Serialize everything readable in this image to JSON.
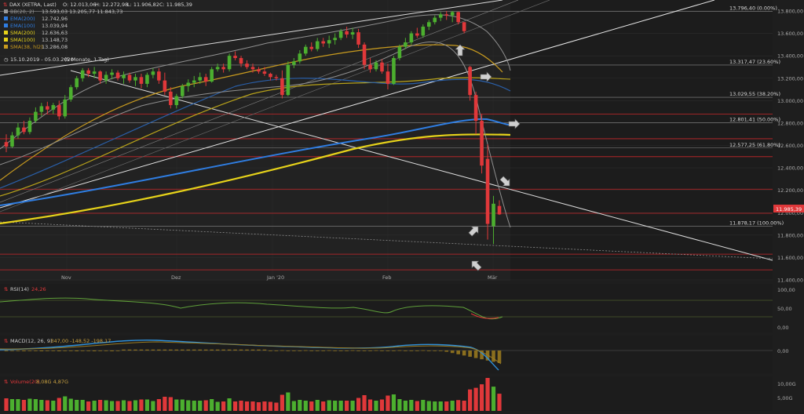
{
  "header": {
    "title": "DAX (XETRA, Last)",
    "ohlc": {
      "o": "O: 12.013,06",
      "h": "H: 12.272,98",
      "l": "L: 11.906,82",
      "c": "C: 11.985,39"
    },
    "period": "15.10.2019 - 05.03.2020",
    "interval": "(5 Monate, 1 Tag)"
  },
  "indicators": [
    {
      "name": "BB(20, 2)",
      "value": "13.593,03   13.205,77   11.843,73",
      "color": "#9a9a9a"
    },
    {
      "name": "EMA(200)",
      "value": "12.742,96",
      "color": "#2f7de1"
    },
    {
      "name": "EMA(100)",
      "value": "13.039,94",
      "color": "#2f7de1"
    },
    {
      "name": "SMA(200)",
      "value": "12.636,63",
      "color": "#e6d21a"
    },
    {
      "name": "SMA(100)",
      "value": "13.148,73",
      "color": "#e6d21a"
    },
    {
      "name": "SMA(38, hl2)",
      "value": "13.286,08",
      "color": "#c79a1f"
    }
  ],
  "colors": {
    "up": "#4caf2f",
    "down": "#e0383a",
    "price_tag": "#e0383a"
  },
  "chart_data": {
    "type": "candlestick",
    "x_tick_labels": [
      "Nov",
      "Dez",
      "Jan '20",
      "Feb",
      "Mär"
    ],
    "y_ticks": [
      "13.800,00",
      "13.600,00",
      "13.400,00",
      "13.200,00",
      "13.000,00",
      "12.800,00",
      "12.600,00",
      "12.400,00",
      "12.200,00",
      "12.000,00",
      "11.800,00",
      "11.600,00",
      "11.400,00"
    ],
    "ylim": [
      11400,
      13900
    ],
    "last_price": "11.985,39",
    "fib_levels": [
      {
        "label": "13.796,40 (0.00%)",
        "value": 13796.4
      },
      {
        "label": "13.317,47 (23.60%)",
        "value": 13317.47
      },
      {
        "label": "13.029,55 (38.20%)",
        "value": 13029.55
      },
      {
        "label": "12.801,41 (50.00%)",
        "value": 12801.41
      },
      {
        "label": "12.577,25 (61.80%)",
        "value": 12577.25
      },
      {
        "label": "11.878,17 (100.00%)",
        "value": 11878.17
      }
    ],
    "horizontal_lines": [
      12880,
      12660,
      12500,
      12210,
      11995,
      11630,
      11490
    ],
    "candles": [
      [
        12630,
        12700,
        12540,
        12590
      ],
      [
        12590,
        12720,
        12580,
        12690
      ],
      [
        12690,
        12800,
        12660,
        12760
      ],
      [
        12760,
        12820,
        12700,
        12720
      ],
      [
        12720,
        12850,
        12700,
        12820
      ],
      [
        12820,
        12940,
        12800,
        12900
      ],
      [
        12900,
        12980,
        12860,
        12950
      ],
      [
        12950,
        12990,
        12880,
        12920
      ],
      [
        12920,
        12980,
        12880,
        12960
      ],
      [
        12960,
        13000,
        12830,
        12860
      ],
      [
        12860,
        13050,
        12840,
        13010
      ],
      [
        13010,
        13140,
        12990,
        13120
      ],
      [
        13120,
        13220,
        13100,
        13200
      ],
      [
        13200,
        13290,
        13170,
        13270
      ],
      [
        13270,
        13290,
        13210,
        13240
      ],
      [
        13240,
        13300,
        13200,
        13260
      ],
      [
        13260,
        13270,
        13150,
        13180
      ],
      [
        13180,
        13260,
        13150,
        13230
      ],
      [
        13230,
        13280,
        13190,
        13250
      ],
      [
        13250,
        13270,
        13180,
        13200
      ],
      [
        13200,
        13260,
        13150,
        13230
      ],
      [
        13230,
        13250,
        13160,
        13180
      ],
      [
        13180,
        13240,
        13130,
        13210
      ],
      [
        13210,
        13240,
        13110,
        13150
      ],
      [
        13150,
        13250,
        13120,
        13230
      ],
      [
        13230,
        13290,
        13200,
        13260
      ],
      [
        13260,
        13290,
        13150,
        13180
      ],
      [
        13180,
        13250,
        13050,
        13080
      ],
      [
        13080,
        13120,
        12930,
        12960
      ],
      [
        12960,
        13060,
        12930,
        13040
      ],
      [
        13040,
        13150,
        13020,
        13130
      ],
      [
        13130,
        13190,
        13080,
        13160
      ],
      [
        13160,
        13220,
        13120,
        13180
      ],
      [
        13180,
        13250,
        13150,
        13210
      ],
      [
        13210,
        13240,
        13130,
        13170
      ],
      [
        13170,
        13300,
        13160,
        13280
      ],
      [
        13280,
        13330,
        13260,
        13300
      ],
      [
        13300,
        13330,
        13250,
        13280
      ],
      [
        13280,
        13420,
        13260,
        13400
      ],
      [
        13400,
        13440,
        13360,
        13380
      ],
      [
        13380,
        13400,
        13300,
        13330
      ],
      [
        13330,
        13360,
        13280,
        13300
      ],
      [
        13300,
        13330,
        13250,
        13280
      ],
      [
        13280,
        13300,
        13240,
        13260
      ],
      [
        13260,
        13300,
        13220,
        13240
      ],
      [
        13240,
        13250,
        13180,
        13210
      ],
      [
        13210,
        13230,
        13180,
        13200
      ],
      [
        13200,
        13270,
        13020,
        13050
      ],
      [
        13050,
        13350,
        13040,
        13320
      ],
      [
        13320,
        13380,
        13290,
        13350
      ],
      [
        13350,
        13450,
        13330,
        13420
      ],
      [
        13420,
        13500,
        13400,
        13480
      ],
      [
        13480,
        13520,
        13440,
        13460
      ],
      [
        13460,
        13560,
        13440,
        13530
      ],
      [
        13530,
        13560,
        13480,
        13510
      ],
      [
        13510,
        13580,
        13470,
        13540
      ],
      [
        13540,
        13600,
        13500,
        13560
      ],
      [
        13560,
        13640,
        13540,
        13620
      ],
      [
        13620,
        13660,
        13560,
        13590
      ],
      [
        13590,
        13650,
        13550,
        13610
      ],
      [
        13610,
        13640,
        13470,
        13500
      ],
      [
        13500,
        13520,
        13280,
        13320
      ],
      [
        13320,
        13380,
        13250,
        13280
      ],
      [
        13280,
        13360,
        13260,
        13340
      ],
      [
        13340,
        13370,
        13240,
        13260
      ],
      [
        13260,
        13330,
        13100,
        13150
      ],
      [
        13150,
        13400,
        13140,
        13380
      ],
      [
        13380,
        13500,
        13360,
        13480
      ],
      [
        13480,
        13560,
        13460,
        13520
      ],
      [
        13520,
        13620,
        13500,
        13600
      ],
      [
        13600,
        13650,
        13560,
        13580
      ],
      [
        13580,
        13680,
        13560,
        13660
      ],
      [
        13660,
        13720,
        13630,
        13700
      ],
      [
        13700,
        13760,
        13680,
        13740
      ],
      [
        13740,
        13790,
        13710,
        13770
      ],
      [
        13770,
        13800,
        13720,
        13760
      ],
      [
        13760,
        13800,
        13700,
        13790
      ],
      [
        13790,
        13795,
        13680,
        13700
      ],
      [
        13700,
        13700,
        13600,
        13620
      ],
      [
        13300,
        13310,
        13000,
        13050
      ],
      [
        13050,
        13080,
        12700,
        12820
      ],
      [
        12820,
        12880,
        12350,
        12420
      ],
      [
        12480,
        12610,
        11760,
        11900
      ],
      [
        11880,
        12150,
        11720,
        12080
      ],
      [
        12060,
        12110,
        11980,
        11985
      ]
    ]
  },
  "rsi": {
    "label": "RSI(14)",
    "value": "24,26",
    "ticks": [
      "100,00",
      "50,00",
      "0,00"
    ]
  },
  "macd": {
    "label": "MACD(12, 26, 9)",
    "values": "-347,00   -148,52   -198,17",
    "ticks": [
      "0,00"
    ]
  },
  "volume": {
    "label": "Volume(20)",
    "values": "8,08G   4,87G",
    "ticks": [
      "10,00G",
      "5,00G"
    ]
  }
}
